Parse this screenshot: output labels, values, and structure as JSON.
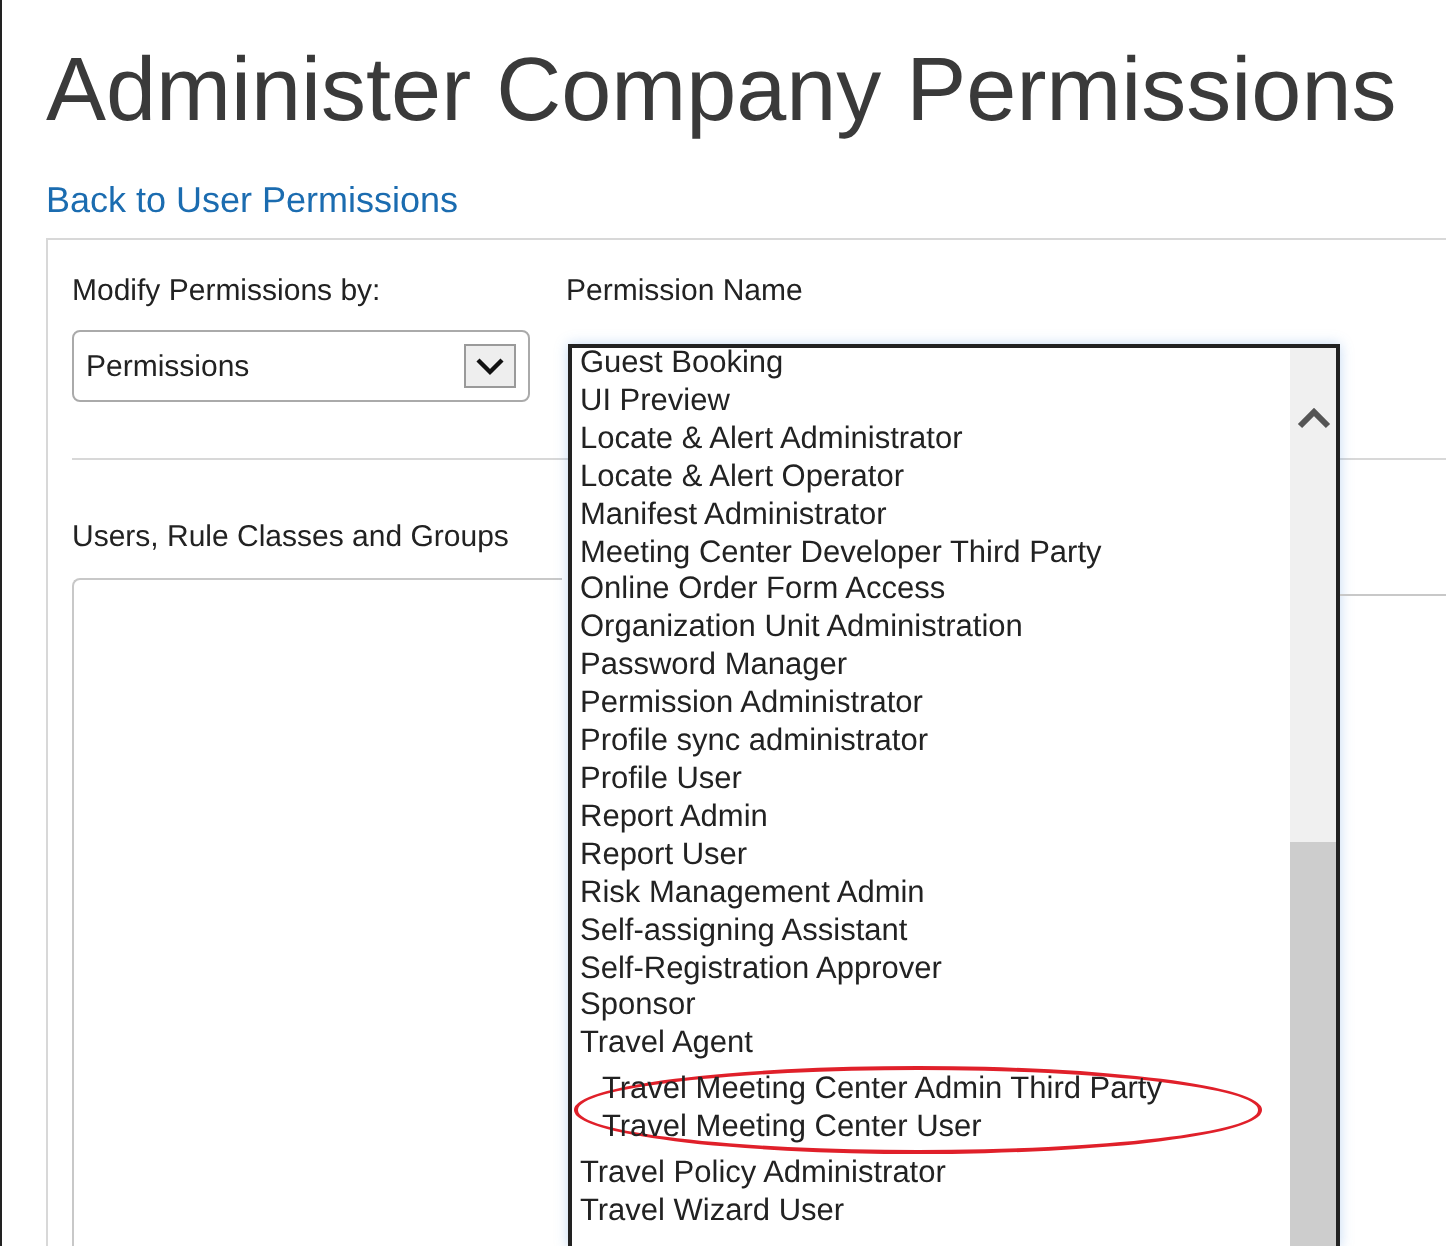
{
  "page": {
    "title": "Administer Company Permissions",
    "back_link": "Back to User Permissions"
  },
  "modify_by": {
    "label": "Modify Permissions by:",
    "value": "Permissions"
  },
  "users_section": {
    "label": "Users, Rule Classes and Groups"
  },
  "permission_name": {
    "label": "Permission Name",
    "items": [
      {
        "text": "Guest Booking",
        "highlighted": false
      },
      {
        "text": "UI Preview",
        "highlighted": false
      },
      {
        "text": "Locate & Alert Administrator",
        "highlighted": false
      },
      {
        "text": "Locate & Alert Operator",
        "highlighted": false
      },
      {
        "text": "Manifest Administrator",
        "highlighted": false
      },
      {
        "text": "Meeting Center Developer Third Party",
        "highlighted": false
      },
      {
        "text": "Online Order Form Access",
        "highlighted": false
      },
      {
        "text": "Organization Unit Administration",
        "highlighted": false
      },
      {
        "text": "Password Manager",
        "highlighted": false
      },
      {
        "text": "Permission Administrator",
        "highlighted": false
      },
      {
        "text": "Profile sync administrator",
        "highlighted": false
      },
      {
        "text": "Profile User",
        "highlighted": false
      },
      {
        "text": "Report Admin",
        "highlighted": false
      },
      {
        "text": "Report User",
        "highlighted": false
      },
      {
        "text": "Risk Management Admin",
        "highlighted": false
      },
      {
        "text": "Self-assigning Assistant",
        "highlighted": false
      },
      {
        "text": "Self-Registration Approver",
        "highlighted": false
      },
      {
        "text": "Sponsor",
        "highlighted": false
      },
      {
        "text": "Travel Agent",
        "highlighted": false
      },
      {
        "text": "Travel Meeting Center Admin Third Party",
        "highlighted": true
      },
      {
        "text": "Travel Meeting Center User",
        "highlighted": true
      },
      {
        "text": "Travel Policy Administrator",
        "highlighted": false
      },
      {
        "text": "Travel Wizard User",
        "highlighted": false
      }
    ]
  }
}
